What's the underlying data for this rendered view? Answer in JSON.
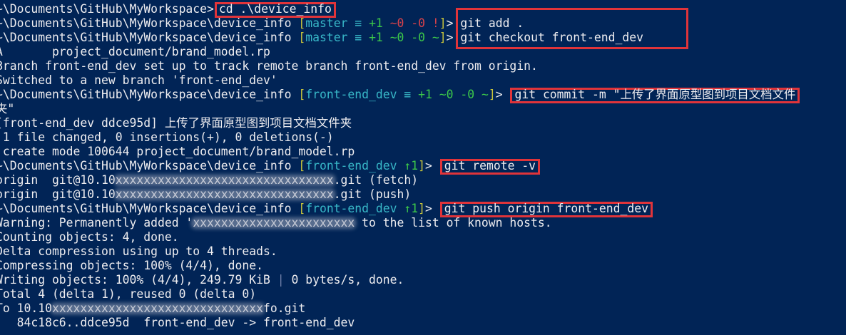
{
  "terminal": {
    "colors": {
      "background": "#012456",
      "text": "#eeedf0",
      "branch": "#c8c43a",
      "branch_name": "#38b8c8",
      "ahead": "#3cc84a",
      "dirty": "#d8424a",
      "highlight_box": "#e0343a"
    },
    "lines": [
      {
        "prompt": "~\\Documents\\GitHub\\MyWorkspace>",
        "cmd": "cd .\\device_info"
      },
      {
        "prompt": "~\\Documents\\GitHub\\MyWorkspace\\device_info",
        "branch": "master",
        "ahead_sym": "≡",
        "staged": "+1",
        "dirty": "~0 -0 !",
        "cmd": "git add ."
      },
      {
        "prompt": "~\\Documents\\GitHub\\MyWorkspace\\device_info",
        "branch": "master",
        "ahead_sym": "≡",
        "staged": "+1",
        "dirty": "~0 -0 ~",
        "cmd": "git checkout front-end_dev"
      },
      {
        "text": "A       project_document/brand_model.rp"
      },
      {
        "text": "Branch front-end_dev set up to track remote branch front-end_dev from origin."
      },
      {
        "text": "Switched to a new branch 'front-end_dev'"
      },
      {
        "prompt": "~\\Documents\\GitHub\\MyWorkspace\\device_info",
        "branch": "front-end_dev",
        "ahead_sym": "≡",
        "staged": "+1",
        "dirty": "~0 -0 ~",
        "cmd": "git commit -m \"上传了界面原型图到项目文档文件"
      },
      {
        "text": "夹\""
      },
      {
        "text": "[front-end_dev ddce95d] 上传了界面原型图到项目文档文件夹"
      },
      {
        "text": " 1 file changed, 0 insertions(+), 0 deletions(-)"
      },
      {
        "text": " create mode 100644 project_document/brand_model.rp"
      },
      {
        "prompt": "~\\Documents\\GitHub\\MyWorkspace\\device_info",
        "branch": "front-end_dev",
        "ahead": "↑1",
        "cmd": "git remote -v"
      },
      {
        "text_a": "origin  git@10.10",
        "text_b": ".git (fetch)"
      },
      {
        "text_a": "origin  git@10.10",
        "text_b": ".git (push)"
      },
      {
        "prompt": "~\\Documents\\GitHub\\MyWorkspace\\device_info",
        "branch": "front-end_dev",
        "ahead": "↑1",
        "cmd": "git push origin front-end_dev"
      },
      {
        "text_a": "Warning: Permanently added '",
        "text_b": " to the list of known hosts."
      },
      {
        "text": "Counting objects: 4, done."
      },
      {
        "text": "Delta compression using up to 4 threads."
      },
      {
        "text": "Compressing objects: 100% (4/4), done."
      },
      {
        "text_a": "Writing objects: 100% (4/4), 249.79 KiB ",
        "sep": "|",
        "text_b": " 0 bytes/s, done."
      },
      {
        "text": "Total 4 (delta 1), reused 0 (delta 0)"
      },
      {
        "text_a": "To 10.10",
        "text_b": "fo.git"
      },
      {
        "text": "   84c18c6..ddce95d  front-end_dev -> front-end_dev"
      }
    ]
  }
}
